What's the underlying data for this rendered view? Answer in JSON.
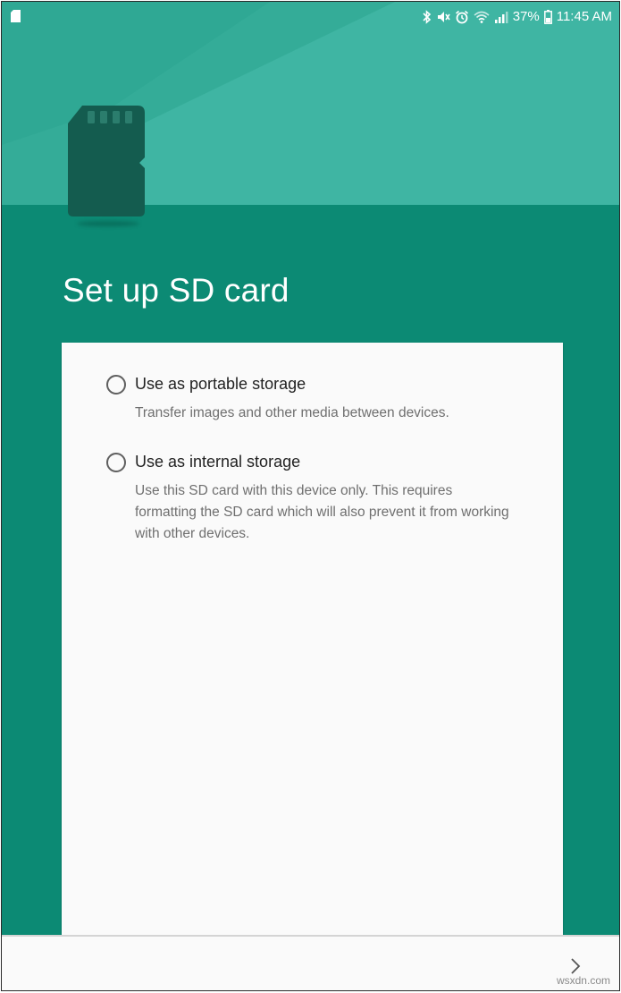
{
  "status_bar": {
    "battery_percent": "37%",
    "time": "11:45 AM"
  },
  "page": {
    "title": "Set up SD card"
  },
  "options": [
    {
      "title": "Use as portable storage",
      "description": "Transfer images and other media between devices.",
      "selected": false
    },
    {
      "title": "Use as internal storage",
      "description": "Use this SD card with this device only. This requires formatting the SD card which will also prevent it from working with other devices.",
      "selected": false
    }
  ],
  "navigation": {
    "next_icon": "chevron-right-icon"
  },
  "watermark": "wsxdn.com",
  "colors": {
    "hero_light": "#3fb5a3",
    "teal_dark": "#0c8a74",
    "card_background": "#fafafa",
    "sd_card": "#145c4f"
  }
}
